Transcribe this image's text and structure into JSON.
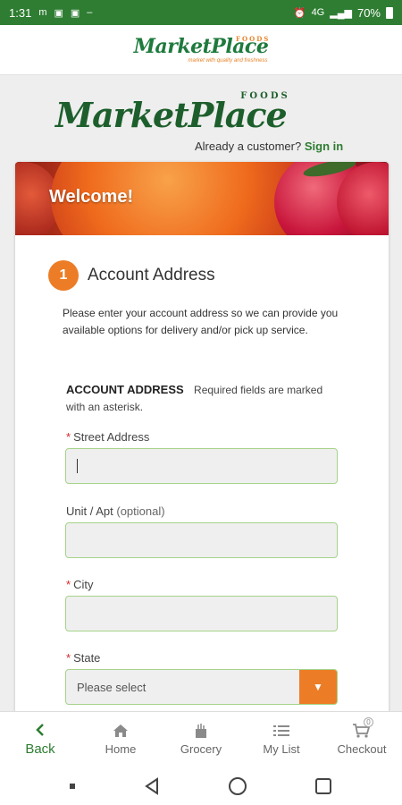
{
  "statusbar": {
    "time": "1:31",
    "network": "4G",
    "battery": "70%"
  },
  "header": {
    "logo_text": "MarketPlace",
    "logo_sub": "FOODS",
    "tagline": "market with quality and freshness"
  },
  "brand": {
    "logo_text": "MarketPlace",
    "logo_sub": "FOODS",
    "customer_prompt": "Already a customer?",
    "signin_label": "Sign in"
  },
  "banner": {
    "title": "Welcome!"
  },
  "step": {
    "number": "1",
    "title": "Account Address"
  },
  "intro": "Please enter your account address so we can provide you available options for delivery and/or pick up service.",
  "section": {
    "heading": "ACCOUNT ADDRESS",
    "note": "Required fields are marked with an asterisk."
  },
  "form": {
    "street": {
      "label": "Street Address",
      "required": "*",
      "value": ""
    },
    "unit": {
      "label": "Unit / Apt",
      "optional": "(optional)",
      "value": ""
    },
    "city": {
      "label": "City",
      "required": "*",
      "value": ""
    },
    "state": {
      "label": "State",
      "required": "*",
      "placeholder": "Please select"
    }
  },
  "nav": [
    {
      "label": "Back",
      "icon": "chevron-left-icon"
    },
    {
      "label": "Home",
      "icon": "home-icon"
    },
    {
      "label": "Grocery",
      "icon": "grocery-bag-icon"
    },
    {
      "label": "My List",
      "icon": "list-icon"
    },
    {
      "label": "Checkout",
      "icon": "cart-icon",
      "badge": "0"
    }
  ],
  "colors": {
    "brand_green": "#2e7d32",
    "accent_orange": "#ec7d26",
    "required_red": "#d7262b",
    "field_border": "#a6d38a"
  }
}
